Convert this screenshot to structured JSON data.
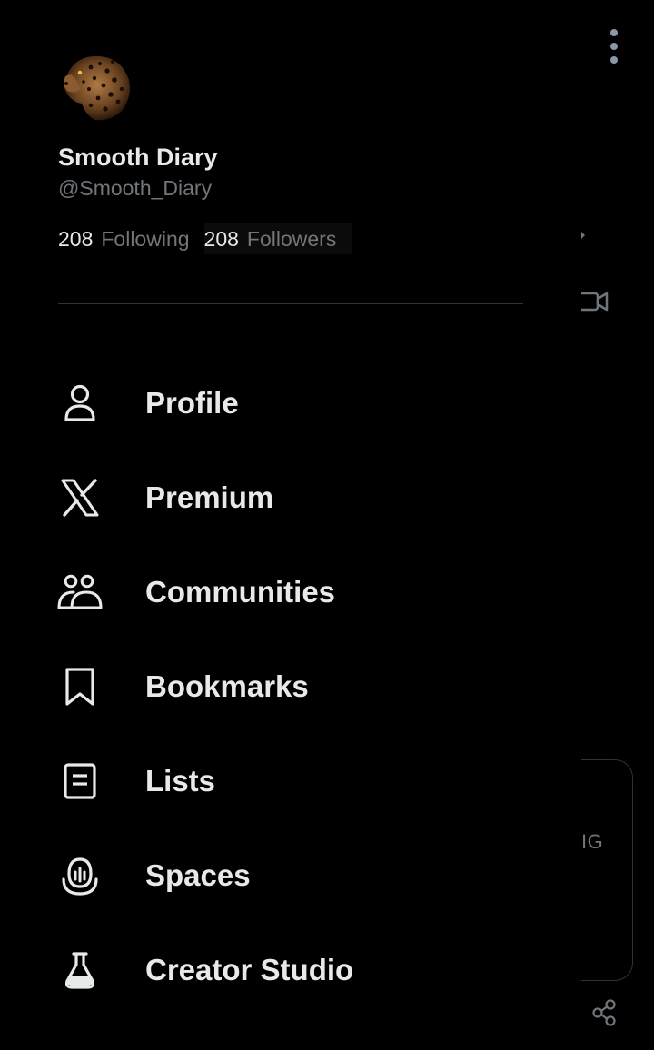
{
  "background": {
    "more_icon": "vertical-dots-icon",
    "video_icon": "video-camera-icon",
    "card_text_fragment": "IG",
    "share_icon": "share-icon"
  },
  "profile": {
    "avatar": "leopard-avatar",
    "display_name": "Smooth Diary",
    "handle": "@Smooth_Diary",
    "following_count": "208",
    "following_label": "Following",
    "followers_count": "208",
    "followers_label": "Followers"
  },
  "menu": {
    "items": [
      {
        "label": "Profile",
        "icon": "person-icon"
      },
      {
        "label": "Premium",
        "icon": "x-logo-icon"
      },
      {
        "label": "Communities",
        "icon": "communities-icon"
      },
      {
        "label": "Bookmarks",
        "icon": "bookmark-icon"
      },
      {
        "label": "Lists",
        "icon": "list-icon"
      },
      {
        "label": "Spaces",
        "icon": "spaces-icon"
      },
      {
        "label": "Creator Studio",
        "icon": "flask-icon"
      }
    ]
  },
  "colors": {
    "background": "#000000",
    "primary_text": "#e7e9ea",
    "secondary_text": "#71767b",
    "divider": "#2f3336"
  }
}
